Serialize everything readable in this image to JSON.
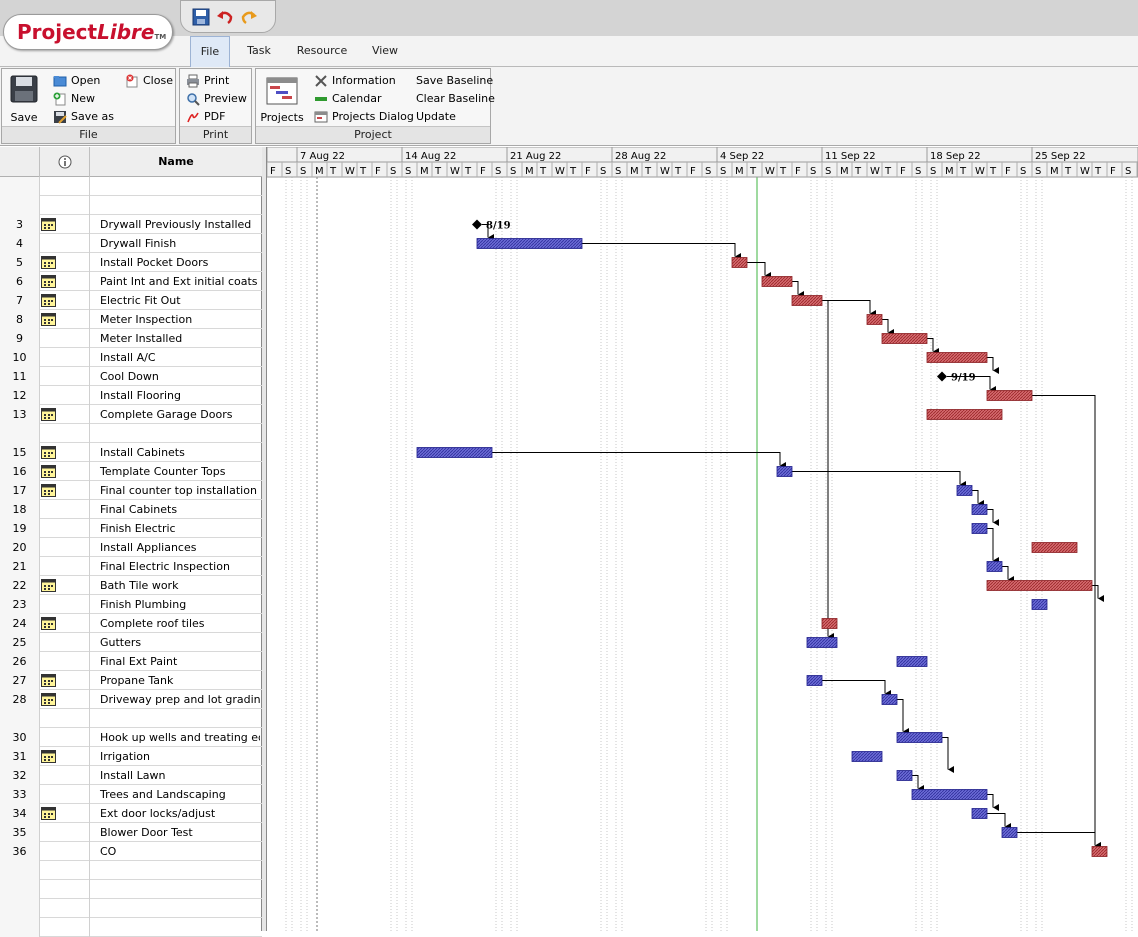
{
  "app": {
    "logo_main": "Project",
    "logo_italic": "Libre",
    "logo_tm": "TM",
    "quick_icons": [
      "save-icon",
      "undo-icon",
      "redo-icon"
    ]
  },
  "tabs": [
    {
      "label": "File",
      "active": true
    },
    {
      "label": "Task",
      "active": false
    },
    {
      "label": "Resource",
      "active": false
    },
    {
      "label": "View",
      "active": false
    }
  ],
  "ribbon": {
    "file": {
      "group_label": "File",
      "save": "Save",
      "open": "Open",
      "new": "New",
      "save_as": "Save as",
      "close": "Close"
    },
    "print": {
      "group_label": "Print",
      "print": "Print",
      "preview": "Preview",
      "pdf": "PDF"
    },
    "project": {
      "group_label": "Project",
      "projects": "Projects",
      "information": "Information",
      "calendar": "Calendar",
      "projects_dialog": "Projects Dialog",
      "save_baseline": "Save Baseline",
      "clear_baseline": "Clear Baseline",
      "update": "Update"
    }
  },
  "table": {
    "header_name": "Name",
    "header_indicator_icon": "info-icon",
    "rows": [
      {
        "id": "",
        "name": "",
        "cal": false
      },
      {
        "id": "",
        "name": "",
        "cal": false
      },
      {
        "id": "3",
        "name": "Drywall Previously Installed",
        "cal": true
      },
      {
        "id": "4",
        "name": "Drywall Finish",
        "cal": false
      },
      {
        "id": "5",
        "name": "Install Pocket Doors",
        "cal": true
      },
      {
        "id": "6",
        "name": "Paint Int and Ext initial coats",
        "cal": true
      },
      {
        "id": "7",
        "name": "Electric Fit Out",
        "cal": true
      },
      {
        "id": "8",
        "name": "Meter Inspection",
        "cal": true
      },
      {
        "id": "9",
        "name": "Meter Installed",
        "cal": false
      },
      {
        "id": "10",
        "name": "Install A/C",
        "cal": false
      },
      {
        "id": "11",
        "name": "Cool Down",
        "cal": false
      },
      {
        "id": "12",
        "name": "Install Flooring",
        "cal": false
      },
      {
        "id": "13",
        "name": "Complete Garage Doors",
        "cal": true
      },
      {
        "id": "",
        "name": "",
        "cal": false
      },
      {
        "id": "15",
        "name": "Install Cabinets",
        "cal": true
      },
      {
        "id": "16",
        "name": "Template Counter Tops",
        "cal": true
      },
      {
        "id": "17",
        "name": "Final counter top installation",
        "cal": true
      },
      {
        "id": "18",
        "name": "Final Cabinets",
        "cal": false
      },
      {
        "id": "19",
        "name": "Finish Electric",
        "cal": false
      },
      {
        "id": "20",
        "name": "Install Appliances",
        "cal": false
      },
      {
        "id": "21",
        "name": "Final Electric Inspection",
        "cal": false
      },
      {
        "id": "22",
        "name": "Bath Tile work",
        "cal": true
      },
      {
        "id": "23",
        "name": "Finish Plumbing",
        "cal": false
      },
      {
        "id": "24",
        "name": "Complete roof tiles",
        "cal": true
      },
      {
        "id": "25",
        "name": "Gutters",
        "cal": false
      },
      {
        "id": "26",
        "name": "Final Ext Paint",
        "cal": false
      },
      {
        "id": "27",
        "name": "Propane Tank",
        "cal": true
      },
      {
        "id": "28",
        "name": "Driveway prep and lot grading",
        "cal": true
      },
      {
        "id": "",
        "name": "",
        "cal": false
      },
      {
        "id": "30",
        "name": "Hook up wells and treating equip",
        "cal": false
      },
      {
        "id": "31",
        "name": "Irrigation",
        "cal": true
      },
      {
        "id": "32",
        "name": "Install Lawn",
        "cal": false
      },
      {
        "id": "33",
        "name": "Trees and Landscaping",
        "cal": false
      },
      {
        "id": "34",
        "name": "Ext door locks/adjust",
        "cal": true
      },
      {
        "id": "35",
        "name": "Blower Door Test",
        "cal": false
      },
      {
        "id": "36",
        "name": "CO",
        "cal": false
      },
      {
        "id": "",
        "name": "",
        "cal": false
      },
      {
        "id": "",
        "name": "",
        "cal": false
      },
      {
        "id": "",
        "name": "",
        "cal": false
      },
      {
        "id": "",
        "name": "",
        "cal": false
      }
    ]
  },
  "timeline": {
    "start_date": "2022-08-05",
    "weeks": [
      "7 Aug 22",
      "14 Aug 22",
      "21 Aug 22",
      "28 Aug 22",
      "4 Sep 22",
      "11 Sep 22",
      "18 Sep 22",
      "25 Sep 22"
    ],
    "day_letters": [
      "F",
      "S",
      "S",
      "M",
      "T",
      "W",
      "T",
      "F",
      "S",
      "S",
      "M",
      "T",
      "W",
      "T",
      "F",
      "S",
      "S",
      "M",
      "T",
      "W",
      "T",
      "F",
      "S",
      "S",
      "M",
      "T",
      "W",
      "T",
      "F",
      "S",
      "S",
      "M",
      "T",
      "W",
      "T",
      "F",
      "S",
      "S",
      "M",
      "T",
      "W",
      "T",
      "F",
      "S",
      "S",
      "M",
      "T",
      "W",
      "T",
      "F",
      "S",
      "S",
      "M",
      "T",
      "W",
      "T",
      "F",
      "S",
      "S"
    ],
    "current_date": "2022-09-06",
    "status_date": "2022-08-08"
  },
  "colors": {
    "normal_bar": "#4f4fc4",
    "critical_bar": "#c9464b",
    "link": "#000000",
    "current_line": "#3fb540",
    "weekend_shade": "#e8e8e8"
  },
  "milestones": [
    {
      "row": 2,
      "date": "2022-08-19",
      "label": "8/19"
    },
    {
      "row": 10,
      "date": "2022-09-19",
      "label": "9/19"
    }
  ],
  "bars": [
    {
      "row": 3,
      "start": "2022-08-19",
      "end": "2022-08-25",
      "critical": false
    },
    {
      "row": 4,
      "start": "2022-09-05",
      "end": "2022-09-05",
      "critical": true
    },
    {
      "row": 5,
      "start": "2022-09-07",
      "end": "2022-09-08",
      "critical": true
    },
    {
      "row": 6,
      "start": "2022-09-09",
      "end": "2022-09-10",
      "critical": true
    },
    {
      "row": 7,
      "start": "2022-09-14",
      "end": "2022-09-14",
      "critical": true
    },
    {
      "row": 8,
      "start": "2022-09-15",
      "end": "2022-09-17",
      "critical": true
    },
    {
      "row": 9,
      "start": "2022-09-18",
      "end": "2022-09-21",
      "critical": true
    },
    {
      "row": 11,
      "start": "2022-09-22",
      "end": "2022-09-24",
      "critical": true
    },
    {
      "row": 12,
      "start": "2022-09-18",
      "end": "2022-09-22",
      "critical": true
    },
    {
      "row": 14,
      "start": "2022-08-15",
      "end": "2022-08-19",
      "critical": false
    },
    {
      "row": 15,
      "start": "2022-09-08",
      "end": "2022-09-08",
      "critical": false
    },
    {
      "row": 16,
      "start": "2022-09-20",
      "end": "2022-09-20",
      "critical": false
    },
    {
      "row": 17,
      "start": "2022-09-21",
      "end": "2022-09-21",
      "critical": false
    },
    {
      "row": 18,
      "start": "2022-09-21",
      "end": "2022-09-21",
      "critical": false
    },
    {
      "row": 19,
      "start": "2022-09-25",
      "end": "2022-09-27",
      "critical": true
    },
    {
      "row": 20,
      "start": "2022-09-22",
      "end": "2022-09-22",
      "critical": false
    },
    {
      "row": 21,
      "start": "2022-09-22",
      "end": "2022-09-28",
      "critical": true
    },
    {
      "row": 22,
      "start": "2022-09-25",
      "end": "2022-09-25",
      "critical": false
    },
    {
      "row": 23,
      "start": "2022-09-11",
      "end": "2022-09-11",
      "critical": true
    },
    {
      "row": 24,
      "start": "2022-09-10",
      "end": "2022-09-11",
      "critical": false
    },
    {
      "row": 25,
      "start": "2022-09-16",
      "end": "2022-09-17",
      "critical": false
    },
    {
      "row": 26,
      "start": "2022-09-10",
      "end": "2022-09-10",
      "critical": false
    },
    {
      "row": 27,
      "start": "2022-09-15",
      "end": "2022-09-15",
      "critical": false
    },
    {
      "row": 29,
      "start": "2022-09-16",
      "end": "2022-09-18",
      "critical": false
    },
    {
      "row": 30,
      "start": "2022-09-13",
      "end": "2022-09-14",
      "critical": false
    },
    {
      "row": 31,
      "start": "2022-09-16",
      "end": "2022-09-16",
      "critical": false
    },
    {
      "row": 32,
      "start": "2022-09-17",
      "end": "2022-09-21",
      "critical": false
    },
    {
      "row": 33,
      "start": "2022-09-21",
      "end": "2022-09-21",
      "critical": false
    },
    {
      "row": 34,
      "start": "2022-09-23",
      "end": "2022-09-23",
      "critical": false
    },
    {
      "row": 35,
      "start": "2022-09-29",
      "end": "2022-09-29",
      "critical": true
    }
  ]
}
